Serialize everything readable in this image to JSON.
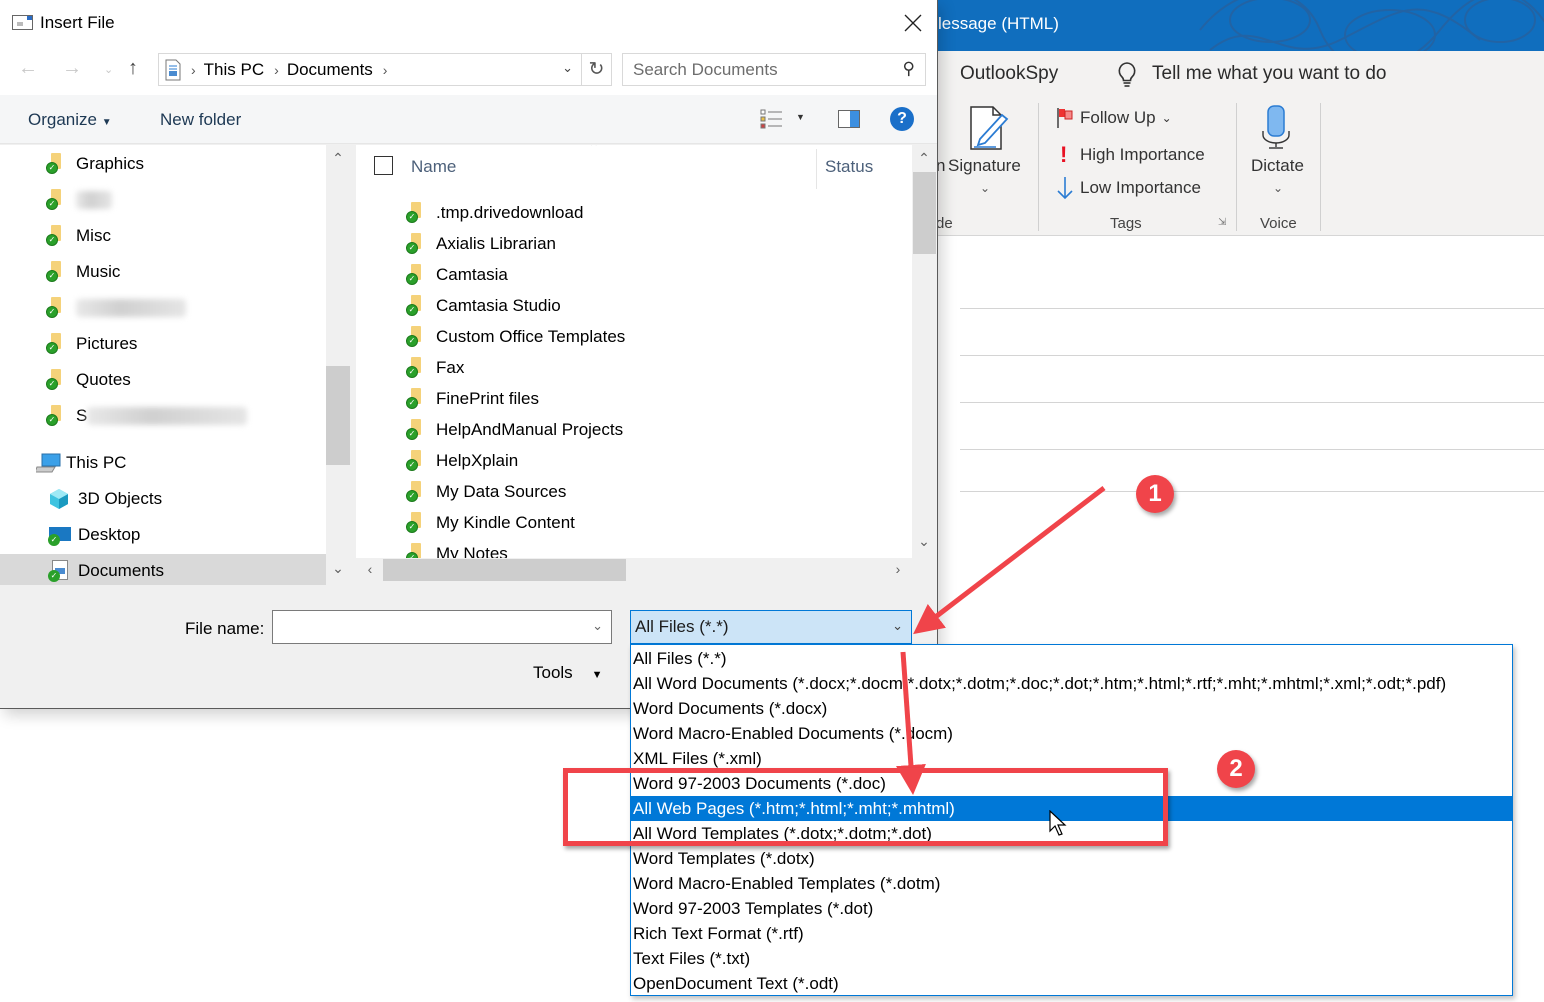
{
  "outlook": {
    "title": "Message (HTML)",
    "title_visible": "lessage (HTML)",
    "menu": {
      "tab_outlookspy": "OutlookSpy",
      "tell_me": "Tell me what you want to do"
    },
    "ribbon": {
      "signature_label": "Signature",
      "group_include_partial": "de",
      "follow_up": "Follow Up",
      "high_importance": "High Importance",
      "low_importance": "Low Importance",
      "group_tags": "Tags",
      "dictate": "Dictate",
      "group_voice": "Voice"
    },
    "colors": {
      "titlebar": "#106ebe"
    }
  },
  "dialog": {
    "title": "Insert File",
    "address": {
      "crumbs": [
        "This PC",
        "Documents"
      ]
    },
    "search_placeholder": "Search Documents",
    "toolbar": {
      "organize": "Organize",
      "new_folder": "New folder"
    },
    "nav_pane": {
      "items": [
        {
          "label": "Graphics",
          "icon": "folder-synced-icon"
        },
        {
          "label": "",
          "icon": "folder-synced-icon",
          "blurred": true
        },
        {
          "label": "Misc",
          "icon": "folder-shared-synced-icon"
        },
        {
          "label": "Music",
          "icon": "folder-synced-icon"
        },
        {
          "label": "",
          "icon": "folder-synced-icon",
          "blurred": true
        },
        {
          "label": "Pictures",
          "icon": "pictures-folder-icon"
        },
        {
          "label": "Quotes",
          "icon": "folder-synced-icon"
        },
        {
          "label": "S",
          "icon": "folder-synced-icon",
          "blurred": true
        },
        {
          "label": "This PC",
          "icon": "computer-icon"
        },
        {
          "label": "3D Objects",
          "icon": "3d-objects-icon"
        },
        {
          "label": "Desktop",
          "icon": "desktop-icon"
        },
        {
          "label": "Documents",
          "icon": "documents-icon",
          "selected": true
        }
      ]
    },
    "file_list": {
      "columns": {
        "name": "Name",
        "status": "Status"
      },
      "rows": [
        ".tmp.drivedownload",
        "Axialis Librarian",
        "Camtasia",
        "Camtasia Studio",
        "Custom Office Templates",
        "Fax",
        "FinePrint files",
        "HelpAndManual Projects",
        "HelpXplain",
        "My Data Sources",
        "My Kindle Content",
        "My Notes"
      ]
    },
    "file_name_label": "File name:",
    "file_name_value": "",
    "file_type_selected": "All Files (*.*)",
    "tools_label": "Tools",
    "file_type_options": [
      "All Files (*.*)",
      "All Word Documents (*.docx;*.docm;*.dotx;*.dotm;*.doc;*.dot;*.htm;*.html;*.rtf;*.mht;*.mhtml;*.xml;*.odt;*.pdf)",
      "Word Documents (*.docx)",
      "Word Macro-Enabled Documents (*.docm)",
      "XML Files (*.xml)",
      "Word 97-2003 Documents (*.doc)",
      "All Web Pages (*.htm;*.html;*.mht;*.mhtml)",
      "All Word Templates (*.dotx;*.dotm;*.dot)",
      "Word Templates (*.dotx)",
      "Word Macro-Enabled Templates (*.dotm)",
      "Word 97-2003 Templates (*.dot)",
      "Rich Text Format (*.rtf)",
      "Text Files (*.txt)",
      "OpenDocument Text (*.odt)"
    ],
    "highlighted_option_index": 6
  },
  "annotations": {
    "badge1": "1",
    "badge2": "2",
    "color": "#f0444a"
  }
}
